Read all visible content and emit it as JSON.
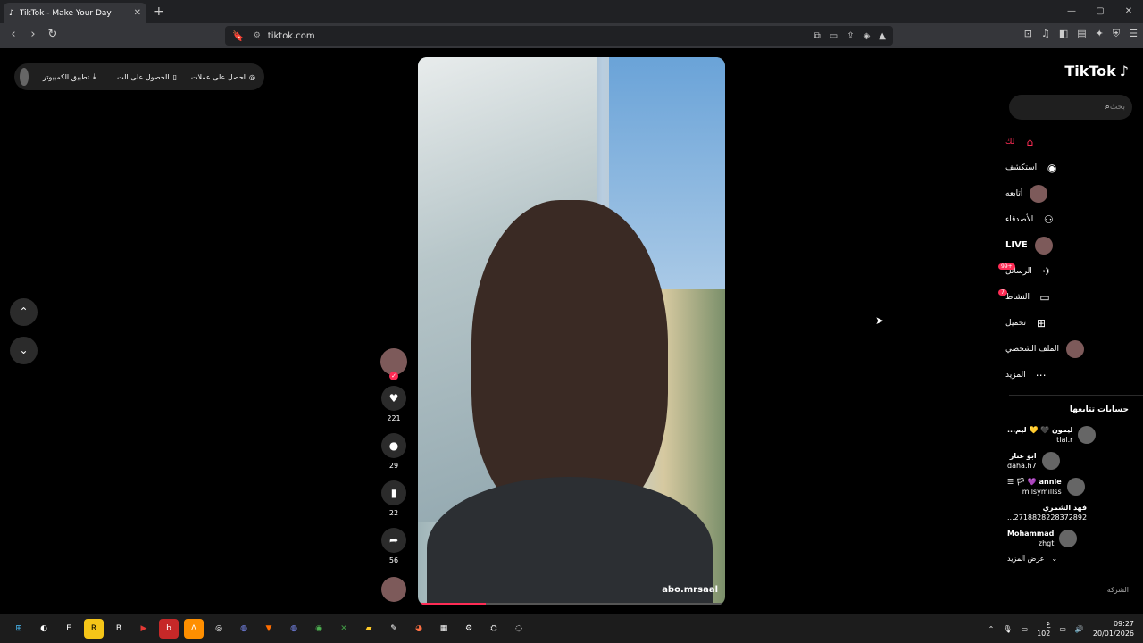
{
  "browser": {
    "tab_title": "TikTok - Make Your Day",
    "url": "tiktok.com",
    "new_tab_symbol": "+",
    "close_symbol": "✕",
    "window_controls": [
      "—",
      "▢",
      "✕"
    ]
  },
  "top_bar": {
    "items": [
      {
        "label": "احصل على عملات",
        "icon": "coin-icon"
      },
      {
        "label": "الحصول على الت...",
        "icon": "phone-icon"
      },
      {
        "label": "تطبيق الكمبيوتر",
        "icon": "download-icon"
      }
    ]
  },
  "video": {
    "author_handle": "abo.mrsaal",
    "progress": 0.22
  },
  "actions": {
    "likes": "221",
    "comments": "29",
    "saves": "22",
    "shares": "56"
  },
  "sidebar": {
    "logo": "TikTok",
    "search_placeholder": "بحث",
    "menu": [
      {
        "label": "لك",
        "icon": "home-icon",
        "active": true
      },
      {
        "label": "استكشف",
        "icon": "compass-icon"
      },
      {
        "label": "أتابعه",
        "icon": "avatar-icon"
      },
      {
        "label": "الأصدقاء",
        "icon": "friends-icon"
      },
      {
        "label": "LIVE",
        "icon": "live-icon"
      },
      {
        "label": "الرسائل",
        "icon": "messages-icon",
        "badge": "+99"
      },
      {
        "label": "النشاط",
        "icon": "activity-icon",
        "badge": "7"
      },
      {
        "label": "تحميل",
        "icon": "upload-icon"
      },
      {
        "label": "الملف الشخصي",
        "icon": "profile-icon"
      },
      {
        "label": "المزيد",
        "icon": "more-icon"
      }
    ],
    "following_title": "حسابات تتابعها",
    "following": [
      {
        "name": "ليمون 🖤 💛 ليم...",
        "handle": "tlal.r"
      },
      {
        "name": "ابو عناز",
        "handle": "daha.h7"
      },
      {
        "name": "annie 💜 🏳 ☰",
        "handle": "milsymillss"
      },
      {
        "name": "فهد الشمري",
        "handle": "2718828228372892..."
      },
      {
        "name": "Mohammad",
        "handle": "zhgt"
      }
    ],
    "see_more": "عرض المزيد",
    "footer_partial": "الشركة"
  },
  "taskbar": {
    "keyboard": "ع",
    "keyboard_sub": "102",
    "time": "09:27",
    "date": "20/01/2026"
  },
  "colors": {
    "accent": "#fe2c55",
    "background": "#000000"
  }
}
